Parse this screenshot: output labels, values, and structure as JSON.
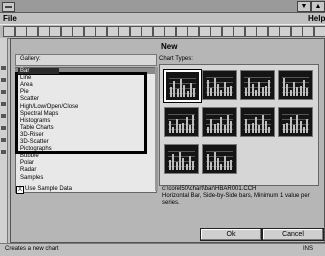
{
  "window": {
    "minimize_glyph": "▼",
    "maximize_glyph": "▲"
  },
  "menubar": {
    "file": "File",
    "help": "Help"
  },
  "dialog": {
    "title": "New",
    "gallery_label": "Gallery:",
    "chart_types_label": "Chart Types:",
    "gallery_items": [
      {
        "label": "Bar",
        "selected": true
      },
      {
        "label": "Line",
        "selected": false
      },
      {
        "label": "Area",
        "selected": false
      },
      {
        "label": "Pie",
        "selected": false
      },
      {
        "label": "Scatter",
        "selected": false
      },
      {
        "label": "High/Low/Open/Close",
        "selected": false
      },
      {
        "label": "Spectral Maps",
        "selected": false
      },
      {
        "label": "Histograms",
        "selected": false
      },
      {
        "label": "Table Charts",
        "selected": false
      },
      {
        "label": "3D-Riser",
        "selected": false
      },
      {
        "label": "3D-Scatter",
        "selected": false
      },
      {
        "label": "Pictographs",
        "selected": false
      },
      {
        "label": "Bubble",
        "selected": false
      },
      {
        "label": "Polar",
        "selected": false
      },
      {
        "label": "Radar",
        "selected": false
      },
      {
        "label": "Samples",
        "selected": false
      }
    ],
    "use_sample_data": {
      "label": "Use Sample Data",
      "checked": true,
      "check_glyph": "X"
    },
    "description_path": "c:\\corel50\\chart\\bar\\HBAR001.CCH",
    "description_text": "Horizontal Bar, Side-by-Side bars, Minimum 1 value per series.",
    "ok_label": "Ok",
    "cancel_label": "Cancel"
  },
  "statusbar": {
    "text": "Creates a new chart",
    "indicator": "INS"
  }
}
